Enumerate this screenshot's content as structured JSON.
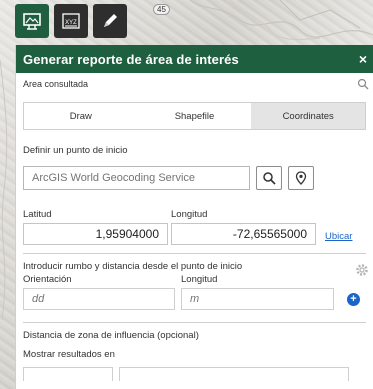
{
  "toolbar": {
    "badge": "45",
    "tools": [
      {
        "name": "report-tool",
        "icon": "map-report-icon"
      },
      {
        "name": "xyz-tool",
        "icon": "xyz-icon"
      },
      {
        "name": "draw-tool",
        "icon": "pencil-icon"
      }
    ]
  },
  "panel": {
    "title": "Generar reporte de área de interés",
    "close_label": "×",
    "area_label": "Area consultada",
    "tabs": [
      {
        "label": "Draw",
        "active": false
      },
      {
        "label": "Shapefile",
        "active": false
      },
      {
        "label": "Coordinates",
        "active": true
      }
    ],
    "start_point_label": "Definir un punto de inicio",
    "search_placeholder": "ArcGIS World Geocoding Service",
    "latitud_label": "Latitud",
    "latitud_value": "1,95904000",
    "longitud_label": "Longitud",
    "longitud_value": "-72,65565000",
    "ubicar_label": "Ubicar",
    "rumbo_label": "Introducir rumbo y distancia desde el punto de inicio",
    "orientacion_label": "Orientación",
    "orientacion_placeholder": "dd",
    "longitud2_label": "Longitud",
    "longitud2_placeholder": "m",
    "buffer_label": "Distancia de zona de influencia (opcional)",
    "results_label": "Mostrar resultados en"
  },
  "colors": {
    "header": "#1e5f3f",
    "active_tool": "#1f5e3f",
    "link": "#1b64c8"
  }
}
